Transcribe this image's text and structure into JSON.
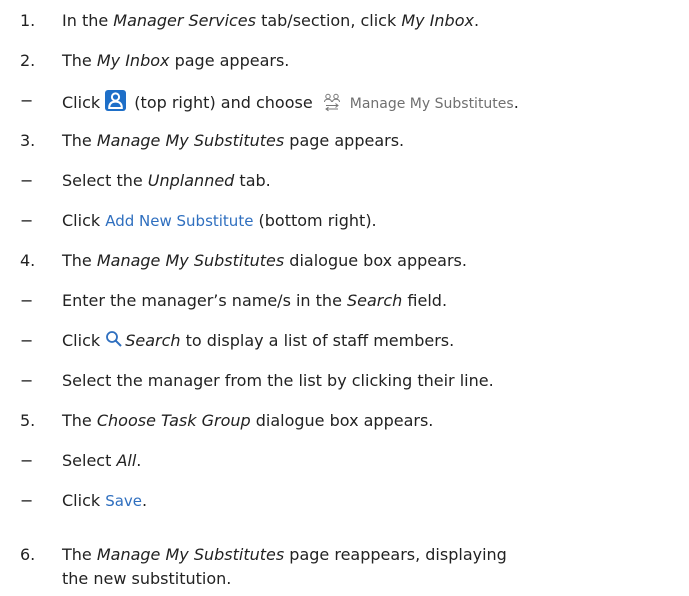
{
  "steps": [
    {
      "marker": "1.",
      "parts": [
        "In the ",
        "Manager Services",
        " tab/section, click ",
        "My Inbox",
        "."
      ]
    },
    {
      "marker": "2.",
      "parts": [
        "The ",
        "My Inbox",
        " page appears."
      ]
    },
    {
      "marker": "−",
      "parts": [
        "Click ",
        " (top right) and choose ",
        "Manage My Substitutes",
        "."
      ]
    },
    {
      "marker": "3.",
      "parts": [
        "The ",
        "Manage My Substitutes",
        " page appears."
      ]
    },
    {
      "marker": "−",
      "parts": [
        "Select the ",
        "Unplanned",
        " tab."
      ]
    },
    {
      "marker": "−",
      "parts": [
        "Click ",
        "Add New Substitute",
        " (bottom right)."
      ]
    },
    {
      "marker": "4.",
      "parts": [
        "The ",
        "Manage My Substitutes",
        " dialogue box appears."
      ]
    },
    {
      "marker": "−",
      "parts": [
        "Enter the manager’s name/s in the ",
        "Search",
        " field."
      ]
    },
    {
      "marker": "−",
      "parts": [
        "Click ",
        "Search",
        " to display a list of staff members."
      ]
    },
    {
      "marker": "−",
      "parts": [
        "Select the manager from the list by clicking their line."
      ]
    },
    {
      "marker": "5.",
      "parts": [
        "The ",
        "Choose Task Group",
        " dialogue box appears."
      ]
    },
    {
      "marker": "−",
      "parts": [
        "Select ",
        "All",
        "."
      ]
    },
    {
      "marker": "−",
      "parts": [
        "Click ",
        "Save",
        "."
      ]
    },
    {
      "marker": "6.",
      "parts": [
        "The ",
        "Manage My Substitutes",
        " page reappears, displaying",
        "the new substitution."
      ]
    }
  ],
  "icons": {
    "user": "user-icon",
    "substitutes": "substitutes-icon",
    "search": "search-icon"
  },
  "colors": {
    "text": "#222222",
    "link_blue": "#2f6fbf",
    "icon_blue": "#1e6fc8",
    "menu_gray": "#707070"
  }
}
